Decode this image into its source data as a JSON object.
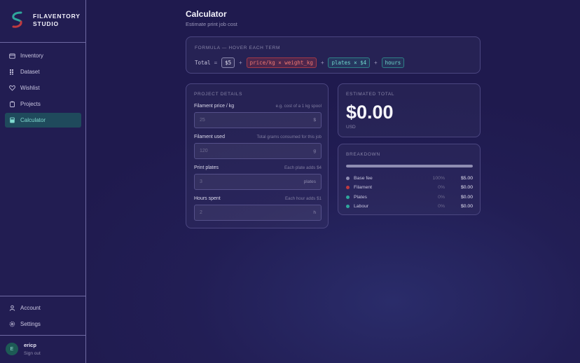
{
  "app": {
    "brand": "FILAVENTORY\nSTUDIO"
  },
  "colors": {
    "accent": "#7fd9cf",
    "base": "#8f8db2",
    "filament": "#c0393f",
    "plates": "#2fa79c",
    "labour": "#2fa79c"
  },
  "sidebar": {
    "items": [
      {
        "label": "Inventory",
        "icon": "box-icon"
      },
      {
        "label": "Dataset",
        "icon": "grid-icon"
      },
      {
        "label": "Wishlist",
        "icon": "heart-icon"
      },
      {
        "label": "Projects",
        "icon": "clipboard-icon"
      },
      {
        "label": "Calculator",
        "icon": "calculator-icon",
        "active": true
      }
    ],
    "bottom": [
      {
        "label": "Account",
        "icon": "user-icon"
      },
      {
        "label": "Settings",
        "icon": "gear-icon"
      }
    ],
    "user": {
      "initial": "E",
      "name": "ericp",
      "action": "Sign out"
    }
  },
  "page": {
    "title": "Calculator",
    "subtitle": "Estimate print job cost"
  },
  "formula": {
    "label": "FORMULA — HOVER EACH TERM",
    "total": "Total",
    "eq": "=",
    "plus": "+",
    "base": "$5",
    "filament": "price/kg × weight_kg",
    "plates": "plates × $4",
    "hours": "hours"
  },
  "details": {
    "label": "PROJECT DETAILS",
    "fields": [
      {
        "label": "Filament price / kg",
        "hint": "e.g. cost of a 1 kg spool",
        "placeholder": "25",
        "unit": "$"
      },
      {
        "label": "Filament used",
        "hint": "Total grams consumed for this job",
        "placeholder": "120",
        "unit": "g"
      },
      {
        "label": "Print plates",
        "hint": "Each plate adds $4",
        "placeholder": "3",
        "unit": "plates"
      },
      {
        "label": "Hours spent",
        "hint": "Each hour adds $1",
        "placeholder": "2",
        "unit": "h"
      }
    ]
  },
  "total": {
    "label": "ESTIMATED TOTAL",
    "value": "$0.00",
    "currency": "USD"
  },
  "breakdown": {
    "label": "BREAKDOWN",
    "fill_fraction": 1.0,
    "rows": [
      {
        "name": "Base fee",
        "pct": "100%",
        "amount": "$5.00",
        "color": "#8f8db2"
      },
      {
        "name": "Filament",
        "pct": "0%",
        "amount": "$0.00",
        "color": "#c0393f"
      },
      {
        "name": "Plates",
        "pct": "0%",
        "amount": "$0.00",
        "color": "#2fa79c"
      },
      {
        "name": "Labour",
        "pct": "0%",
        "amount": "$0.00",
        "color": "#2fa79c"
      }
    ]
  }
}
